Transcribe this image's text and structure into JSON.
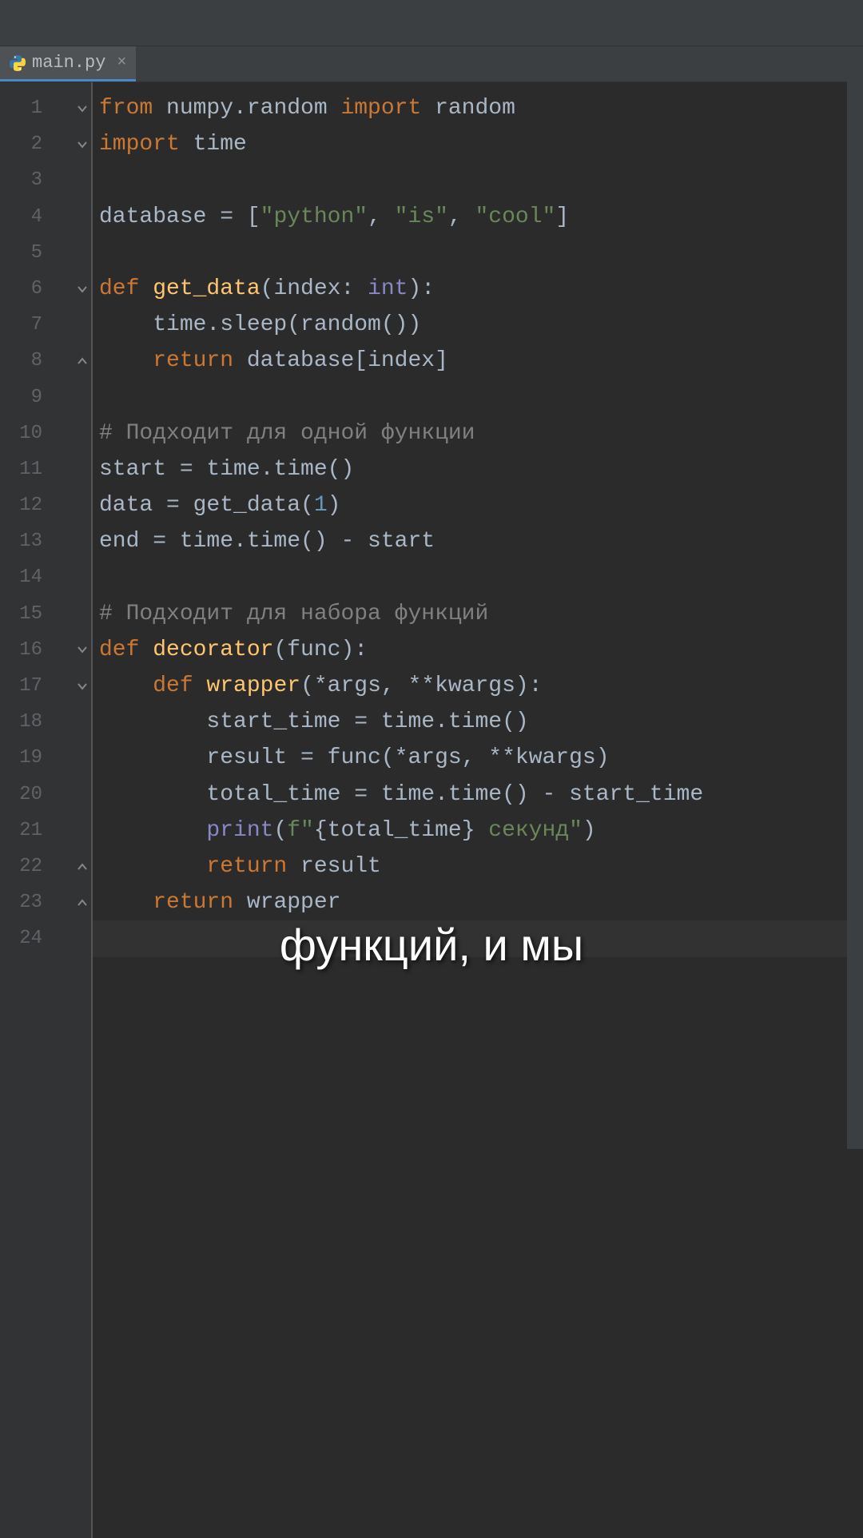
{
  "tab": {
    "filename": "main.py"
  },
  "caption": "функций, и мы",
  "line_numbers": [
    "1",
    "2",
    "3",
    "4",
    "5",
    "6",
    "7",
    "8",
    "9",
    "10",
    "11",
    "12",
    "13",
    "14",
    "15",
    "16",
    "17",
    "18",
    "19",
    "20",
    "21",
    "22",
    "23",
    "24"
  ],
  "folds": {
    "1": "down",
    "2": "down",
    "6": "down",
    "8": "up",
    "16": "down",
    "17": "down",
    "22": "up",
    "23": "up"
  },
  "code": [
    [
      [
        "kw",
        "from "
      ],
      [
        "id",
        "numpy.random "
      ],
      [
        "kw",
        "import "
      ],
      [
        "id",
        "random"
      ]
    ],
    [
      [
        "kw",
        "import "
      ],
      [
        "id",
        "time"
      ]
    ],
    [
      [
        "id",
        ""
      ]
    ],
    [
      [
        "id",
        "database = ["
      ],
      [
        "str",
        "\"python\""
      ],
      [
        "id",
        ", "
      ],
      [
        "str",
        "\"is\""
      ],
      [
        "id",
        ", "
      ],
      [
        "str",
        "\"cool\""
      ],
      [
        "id",
        "]"
      ]
    ],
    [
      [
        "id",
        ""
      ]
    ],
    [
      [
        "kw",
        "def "
      ],
      [
        "fn",
        "get_data"
      ],
      [
        "id",
        "(index: "
      ],
      [
        "builtin",
        "int"
      ],
      [
        "id",
        "):"
      ]
    ],
    [
      [
        "id",
        "    time.sleep(random())"
      ]
    ],
    [
      [
        "id",
        "    "
      ],
      [
        "kw",
        "return "
      ],
      [
        "id",
        "database[index]"
      ]
    ],
    [
      [
        "id",
        ""
      ]
    ],
    [
      [
        "com",
        "# Подходит для одной функции"
      ]
    ],
    [
      [
        "id",
        "start = time.time()"
      ]
    ],
    [
      [
        "id",
        "data = get_data("
      ],
      [
        "num",
        "1"
      ],
      [
        "id",
        ")"
      ]
    ],
    [
      [
        "id",
        "end = time.time() - start"
      ]
    ],
    [
      [
        "id",
        ""
      ]
    ],
    [
      [
        "com",
        "# Подходит для набора функций"
      ]
    ],
    [
      [
        "kw",
        "def "
      ],
      [
        "fn",
        "decorator"
      ],
      [
        "id",
        "(func):"
      ]
    ],
    [
      [
        "id",
        "    "
      ],
      [
        "kw",
        "def "
      ],
      [
        "fn",
        "wrapper"
      ],
      [
        "id",
        "(*args, **kwargs):"
      ]
    ],
    [
      [
        "id",
        "        start_time = time.time()"
      ]
    ],
    [
      [
        "id",
        "        result = func(*args, **kwargs)"
      ]
    ],
    [
      [
        "id",
        "        total_time = time.time() - start_time"
      ]
    ],
    [
      [
        "id",
        "        "
      ],
      [
        "builtin",
        "print"
      ],
      [
        "id",
        "("
      ],
      [
        "str",
        "f\""
      ],
      [
        "id",
        "{total_time} "
      ],
      [
        "str",
        "секунд\""
      ],
      [
        "id",
        ")"
      ]
    ],
    [
      [
        "id",
        "        "
      ],
      [
        "kw",
        "return "
      ],
      [
        "id",
        "result"
      ]
    ],
    [
      [
        "id",
        "    "
      ],
      [
        "kw",
        "return "
      ],
      [
        "id",
        "wrapper"
      ]
    ],
    [
      [
        "id",
        ""
      ]
    ]
  ],
  "highlighted_line": 24
}
